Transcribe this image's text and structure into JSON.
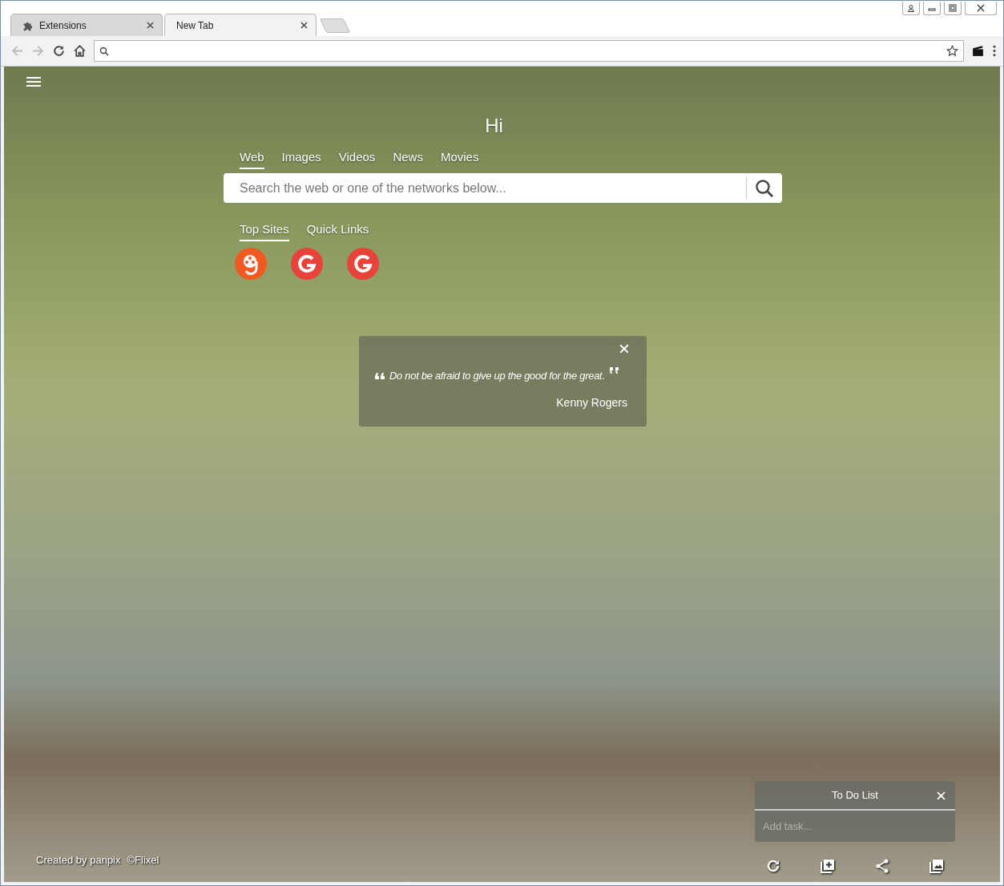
{
  "browser": {
    "tabs": [
      {
        "label": "Extensions",
        "selected": false
      },
      {
        "label": "New Tab",
        "selected": true
      }
    ]
  },
  "page": {
    "greeting": "Hi",
    "search_tabs": [
      {
        "label": "Web",
        "selected": true
      },
      {
        "label": "Images",
        "selected": false
      },
      {
        "label": "Videos",
        "selected": false
      },
      {
        "label": "News",
        "selected": false
      },
      {
        "label": "Movies",
        "selected": false
      }
    ],
    "search": {
      "placeholder": "Search the web or one of the networks below..."
    },
    "site_tabs": [
      {
        "label": "Top Sites",
        "selected": true
      },
      {
        "label": "Quick Links",
        "selected": false
      }
    ],
    "top_sites": [
      {
        "kind": "reel"
      },
      {
        "kind": "g"
      },
      {
        "kind": "g"
      }
    ],
    "quote": {
      "text": "Do not be afraid to give up the good for the great.",
      "author": "Kenny Rogers"
    },
    "credits": [
      "Created by panpix",
      "©Flixel"
    ],
    "todo": {
      "title": "To Do List",
      "placeholder": "Add task..."
    }
  }
}
